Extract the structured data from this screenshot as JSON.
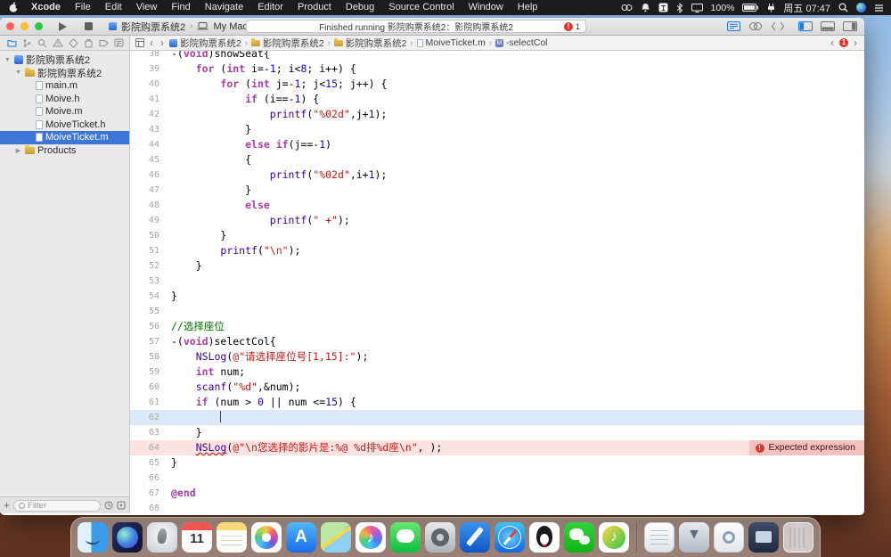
{
  "menu_bar": {
    "apple_icon": "apple-logo",
    "items": [
      "Xcode",
      "File",
      "Edit",
      "View",
      "Find",
      "Navigate",
      "Editor",
      "Product",
      "Debug",
      "Source Control",
      "Window",
      "Help"
    ],
    "status_icons": [
      "headphones",
      "notifications",
      "input-source",
      "bluetooth",
      "display",
      "battery-text",
      "battery",
      "ac-power",
      "clock",
      "spotlight",
      "siri",
      "notification-center"
    ],
    "battery_percent": "100%",
    "clock": "周五 07:47"
  },
  "toolbar": {
    "scheme": "影院购票系统2",
    "destination": "My Mac",
    "status_text": "Finished running 影院购票系统2：影院购票系统2",
    "issue_count": "1"
  },
  "navigator": {
    "strip": [
      "project",
      "source-control",
      "search",
      "issues",
      "tests",
      "debug",
      "breakpoints",
      "reports"
    ],
    "active_strip_index": 0,
    "tree": [
      {
        "label": "影院购票系统2",
        "level": 0,
        "icon": "project",
        "disclosure": "open"
      },
      {
        "label": "影院购票系统2",
        "level": 1,
        "icon": "folder",
        "disclosure": "open"
      },
      {
        "label": "main.m",
        "level": 2,
        "icon": "file"
      },
      {
        "label": "Moive.h",
        "level": 2,
        "icon": "file"
      },
      {
        "label": "Moive.m",
        "level": 2,
        "icon": "file"
      },
      {
        "label": "MoiveTicket.h",
        "level": 2,
        "icon": "file"
      },
      {
        "label": "MoiveTicket.m",
        "level": 2,
        "icon": "file",
        "selected": true
      },
      {
        "label": "Products",
        "level": 1,
        "icon": "folder",
        "disclosure": "closed"
      }
    ],
    "filter_placeholder": "Filter"
  },
  "jump_bar": {
    "crumbs": [
      {
        "label": "影院购票系统2",
        "icon": "project"
      },
      {
        "label": "影院购票系统2",
        "icon": "folder"
      },
      {
        "label": "影院购票系统2",
        "icon": "folder"
      },
      {
        "label": "MoiveTicket.m",
        "icon": "file"
      },
      {
        "label": "-selectCol",
        "icon": "method"
      }
    ],
    "issue_count": "1"
  },
  "editor": {
    "current_line": 62,
    "error_line": 64,
    "error_message": "Expected expression",
    "lines": [
      {
        "n": 38,
        "segs": [
          [
            "p",
            "-("
          ],
          [
            "k",
            "void"
          ],
          [
            "p",
            ")showSeat{"
          ]
        ]
      },
      {
        "n": 39,
        "segs": [
          [
            "p",
            "    "
          ],
          [
            "k",
            "for"
          ],
          [
            "p",
            " ("
          ],
          [
            "k",
            "int"
          ],
          [
            "p",
            " i=-"
          ],
          [
            "n",
            "1"
          ],
          [
            "p",
            "; i<"
          ],
          [
            "n",
            "8"
          ],
          [
            "p",
            "; i++) {"
          ]
        ]
      },
      {
        "n": 40,
        "segs": [
          [
            "p",
            "        "
          ],
          [
            "k",
            "for"
          ],
          [
            "p",
            " ("
          ],
          [
            "k",
            "int"
          ],
          [
            "p",
            " j=-"
          ],
          [
            "n",
            "1"
          ],
          [
            "p",
            "; j<"
          ],
          [
            "n",
            "15"
          ],
          [
            "p",
            "; j++) {"
          ]
        ]
      },
      {
        "n": 41,
        "segs": [
          [
            "p",
            "            "
          ],
          [
            "k",
            "if"
          ],
          [
            "p",
            " (i==-"
          ],
          [
            "n",
            "1"
          ],
          [
            "p",
            ") {"
          ]
        ]
      },
      {
        "n": 42,
        "segs": [
          [
            "p",
            "                "
          ],
          [
            "f",
            "printf"
          ],
          [
            "p",
            "("
          ],
          [
            "s",
            "\"%02d\""
          ],
          [
            "p",
            ",j+"
          ],
          [
            "n",
            "1"
          ],
          [
            "p",
            ");"
          ]
        ]
      },
      {
        "n": 43,
        "segs": [
          [
            "p",
            "            }"
          ]
        ]
      },
      {
        "n": 44,
        "segs": [
          [
            "p",
            "            "
          ],
          [
            "k",
            "else"
          ],
          [
            "p",
            " "
          ],
          [
            "k",
            "if"
          ],
          [
            "p",
            "(j==-"
          ],
          [
            "n",
            "1"
          ],
          [
            "p",
            ")"
          ]
        ]
      },
      {
        "n": 45,
        "segs": [
          [
            "p",
            "            {"
          ]
        ]
      },
      {
        "n": 46,
        "segs": [
          [
            "p",
            "                "
          ],
          [
            "f",
            "printf"
          ],
          [
            "p",
            "("
          ],
          [
            "s",
            "\"%02d\""
          ],
          [
            "p",
            ",i+"
          ],
          [
            "n",
            "1"
          ],
          [
            "p",
            ");"
          ]
        ]
      },
      {
        "n": 47,
        "segs": [
          [
            "p",
            "            }"
          ]
        ]
      },
      {
        "n": 48,
        "segs": [
          [
            "p",
            "            "
          ],
          [
            "k",
            "else"
          ]
        ]
      },
      {
        "n": 49,
        "segs": [
          [
            "p",
            "                "
          ],
          [
            "f",
            "printf"
          ],
          [
            "p",
            "("
          ],
          [
            "s",
            "\" +\""
          ],
          [
            "p",
            ");"
          ]
        ]
      },
      {
        "n": 50,
        "segs": [
          [
            "p",
            "        }"
          ]
        ]
      },
      {
        "n": 51,
        "segs": [
          [
            "p",
            "        "
          ],
          [
            "f",
            "printf"
          ],
          [
            "p",
            "("
          ],
          [
            "s",
            "\"\\n\""
          ],
          [
            "p",
            ");"
          ]
        ]
      },
      {
        "n": 52,
        "segs": [
          [
            "p",
            "    }"
          ]
        ]
      },
      {
        "n": 53,
        "segs": []
      },
      {
        "n": 54,
        "segs": [
          [
            "p",
            "}"
          ]
        ]
      },
      {
        "n": 55,
        "segs": []
      },
      {
        "n": 56,
        "segs": [
          [
            "c",
            "//选择座位"
          ]
        ]
      },
      {
        "n": 57,
        "segs": [
          [
            "p",
            "-("
          ],
          [
            "k",
            "void"
          ],
          [
            "p",
            ")selectCol{"
          ]
        ]
      },
      {
        "n": 58,
        "segs": [
          [
            "p",
            "    "
          ],
          [
            "f",
            "NSLog"
          ],
          [
            "p",
            "("
          ],
          [
            "s",
            "@\"请选择座位号[1,15]:\""
          ],
          [
            "p",
            ");"
          ]
        ]
      },
      {
        "n": 59,
        "segs": [
          [
            "p",
            "    "
          ],
          [
            "k",
            "int"
          ],
          [
            "p",
            " num;"
          ]
        ]
      },
      {
        "n": 60,
        "segs": [
          [
            "p",
            "    "
          ],
          [
            "f",
            "scanf"
          ],
          [
            "p",
            "("
          ],
          [
            "s",
            "\"%d\""
          ],
          [
            "p",
            ",&num);"
          ]
        ]
      },
      {
        "n": 61,
        "segs": [
          [
            "p",
            "    "
          ],
          [
            "k",
            "if"
          ],
          [
            "p",
            " (num > "
          ],
          [
            "n",
            "0"
          ],
          [
            "p",
            " || num <="
          ],
          [
            "n",
            "15"
          ],
          [
            "p",
            ") {"
          ]
        ]
      },
      {
        "n": 62,
        "segs": [
          [
            "p",
            "        "
          ]
        ]
      },
      {
        "n": 63,
        "segs": [
          [
            "p",
            "    }"
          ]
        ]
      },
      {
        "n": 64,
        "segs": [
          [
            "p",
            "    "
          ],
          [
            "fu",
            "NSLog"
          ],
          [
            "p",
            "("
          ],
          [
            "s",
            "@\"\\n您选择的影片是:%@ %d排%d座\\n\""
          ],
          [
            "p",
            ", );"
          ]
        ]
      },
      {
        "n": 65,
        "segs": [
          [
            "p",
            "}"
          ]
        ]
      },
      {
        "n": 66,
        "segs": []
      },
      {
        "n": 67,
        "segs": [
          [
            "k",
            "@end"
          ]
        ]
      },
      {
        "n": 68,
        "segs": []
      }
    ]
  },
  "dock": {
    "apps": [
      "finder",
      "siri",
      "launchpad",
      "calendar",
      "notes",
      "photos",
      "appstore",
      "maps",
      "itunes",
      "messages",
      "settings",
      "xcode",
      "safari",
      "qq",
      "wechat",
      "qqmusic"
    ],
    "calendar_day": "11",
    "stacks": [
      "documents",
      "downloads",
      "applications",
      "bin"
    ],
    "trash": "trash"
  },
  "colors": {
    "selection_blue": "#3E75D8",
    "accent_blue": "#1B79EE",
    "error_red": "#E0352B",
    "keyword": "#AD3DA4",
    "string": "#C41A16",
    "number": "#1C00CF",
    "function": "#3900A0",
    "comment": "#007400",
    "current_line_bg": "#DCE9F8",
    "error_line_bg": "#FBE3E2"
  }
}
